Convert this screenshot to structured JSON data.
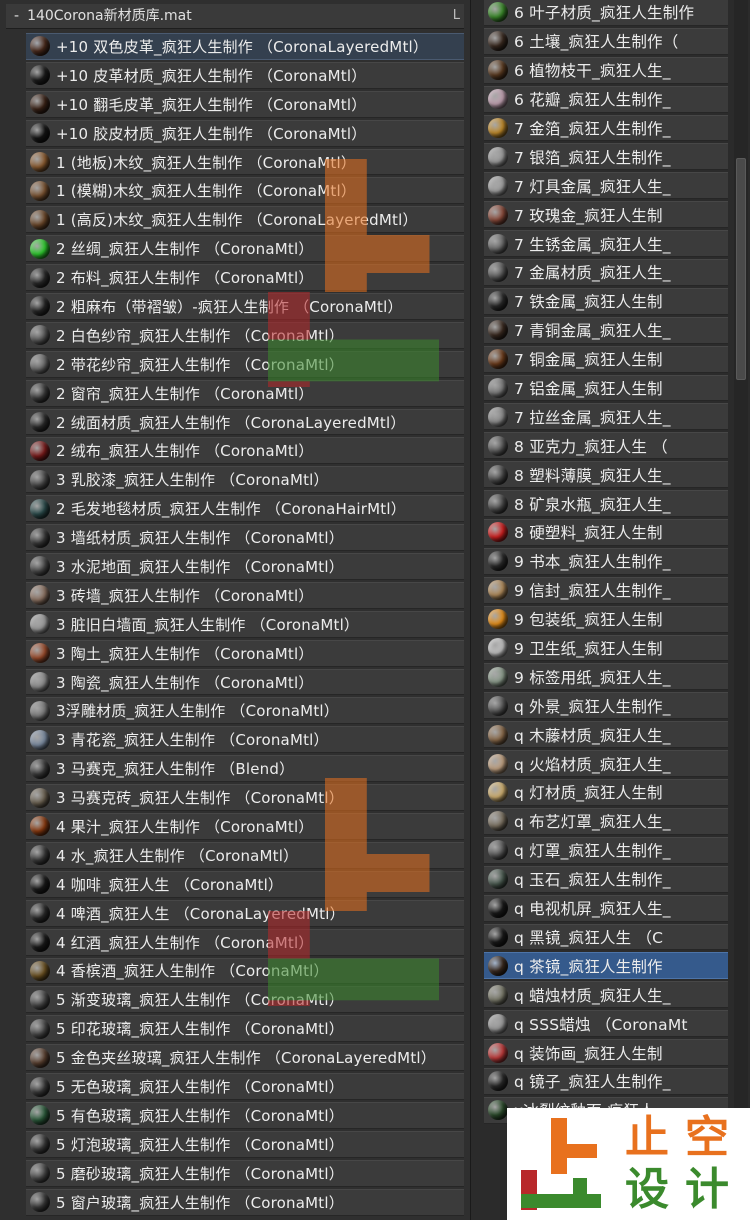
{
  "panel_title": "140Corona新材质库.mat",
  "collapse_symbol": "-",
  "corner_label": "L",
  "colors": {
    "row_bg": "#3b3b3b",
    "selected_left": "#34404f",
    "selected_right": "#355a8c",
    "watermark_orange": "#e8711e",
    "watermark_green": "#3b8a2d",
    "watermark_red": "#b8282a"
  },
  "left_items": [
    {
      "label": "+10 双色皮革_疯狂人生制作 （CoronaLayeredMtl）",
      "swatch": "#4a2a1c",
      "selected": true
    },
    {
      "label": "+10 皮革材质_疯狂人生制作 （CoronaMtl）",
      "swatch": "#1c1c1c"
    },
    {
      "label": "+10 翻毛皮革_疯狂人生制作 （CoronaMtl）",
      "swatch": "#3a2216"
    },
    {
      "label": "+10 胶皮材质_疯狂人生制作 （CoronaMtl）",
      "swatch": "#151515"
    },
    {
      "label": "1 (地板)木纹_疯狂人生制作 （CoronaMtl）",
      "swatch": "#8a5a2e"
    },
    {
      "label": "1 (模糊)木纹_疯狂人生制作 （CoronaMtl）",
      "swatch": "#7a5230"
    },
    {
      "label": "1 (高反)木纹_疯狂人生制作 （CoronaLayeredMtl）",
      "swatch": "#6a4628"
    },
    {
      "label": "2 丝绸_疯狂人生制作 （CoronaMtl）",
      "swatch": "#2ecc2e"
    },
    {
      "label": "2 布料_疯狂人生制作 （CoronaMtl）",
      "swatch": "#2a2a2a"
    },
    {
      "label": "2 粗麻布（带褶皱）-疯狂人生制作 （CoronaMtl）",
      "swatch": "#262626"
    },
    {
      "label": "2 白色纱帘_疯狂人生制作 （CoronaMtl）",
      "swatch": "#5a5a5a"
    },
    {
      "label": "2 带花纱帘_疯狂人生制作 （CoronaMtl）",
      "swatch": "#6a6a6a"
    },
    {
      "label": "2 窗帘_疯狂人生制作 （CoronaMtl）",
      "swatch": "#3a3a3a"
    },
    {
      "label": "2 绒面材质_疯狂人生制作 （CoronaLayeredMtl）",
      "swatch": "#2a2a2a"
    },
    {
      "label": "2 绒布_疯狂人生制作 （CoronaMtl）",
      "swatch": "#7a1a1a"
    },
    {
      "label": "3 乳胶漆_疯狂人生制作 （CoronaMtl）",
      "swatch": "#4a4a4a"
    },
    {
      "label": "2 毛发地毯材质_疯狂人生制作 （CoronaHairMtl）",
      "swatch": "#2a4a4a"
    },
    {
      "label": "3 墙纸材质_疯狂人生制作 （CoronaMtl）",
      "swatch": "#3a3a3a"
    },
    {
      "label": "3 水泥地面_疯狂人生制作 （CoronaMtl）",
      "swatch": "#4a4a4a"
    },
    {
      "label": "3 砖墙_疯狂人生制作 （CoronaMtl）",
      "swatch": "#8a7060"
    },
    {
      "label": "3 脏旧白墙面_疯狂人生制作 （CoronaMtl）",
      "swatch": "#9a9a9a"
    },
    {
      "label": "3 陶土_疯狂人生制作 （CoronaMtl）",
      "swatch": "#9a4a2a"
    },
    {
      "label": "3 陶瓷_疯狂人生制作 （CoronaMtl）",
      "swatch": "#8a8a8a"
    },
    {
      "label": "3浮雕材质_疯狂人生制作 （CoronaMtl）",
      "swatch": "#7a7a7a"
    },
    {
      "label": "3 青花瓷_疯狂人生制作 （CoronaMtl）",
      "swatch": "#7a8aa0"
    },
    {
      "label": "3 马赛克_疯狂人生制作 （Blend）",
      "swatch": "#3a3a3a"
    },
    {
      "label": "3 马赛克砖_疯狂人生制作 （CoronaMtl）",
      "swatch": "#6a6050"
    },
    {
      "label": "4 果汁_疯狂人生制作 （CoronaMtl）",
      "swatch": "#8a3a10"
    },
    {
      "label": "4 水_疯狂人生制作 （CoronaMtl）",
      "swatch": "#3a3a3a"
    },
    {
      "label": "4 咖啡_疯狂人生 （CoronaMtl）",
      "swatch": "#1a1a1a"
    },
    {
      "label": "4 啤酒_疯狂人生 （CoronaLayeredMtl）",
      "swatch": "#2a2a2a"
    },
    {
      "label": "4 红酒_疯狂人生制作 （CoronaMtl）",
      "swatch": "#1a1a1a"
    },
    {
      "label": "4 香槟酒_疯狂人生制作 （CoronaMtl）",
      "swatch": "#6a5020"
    },
    {
      "label": "5 渐变玻璃_疯狂人生制作 （CoronaMtl）",
      "swatch": "#4a4a4a"
    },
    {
      "label": "5 印花玻璃_疯狂人生制作 （CoronaMtl）",
      "swatch": "#4a4a4a"
    },
    {
      "label": "5 金色夹丝玻璃_疯狂人生制作 （CoronaLayeredMtl）",
      "swatch": "#5a4030"
    },
    {
      "label": "5 无色玻璃_疯狂人生制作 （CoronaMtl）",
      "swatch": "#3a3a3a"
    },
    {
      "label": "5 有色玻璃_疯狂人生制作 （CoronaMtl）",
      "swatch": "#2a5a3a"
    },
    {
      "label": "5 灯泡玻璃_疯狂人生制作 （CoronaMtl）",
      "swatch": "#3a3a3a"
    },
    {
      "label": "5 磨砂玻璃_疯狂人生制作 （CoronaMtl）",
      "swatch": "#4a4a4a"
    },
    {
      "label": "5 窗户玻璃_疯狂人生制作 （CoronaMtl）",
      "swatch": "#3a3a3a"
    }
  ],
  "right_items": [
    {
      "label": "6 叶子材质_疯狂人生制作",
      "swatch": "#3a8a2a"
    },
    {
      "label": "6 土壤_疯狂人生制作（",
      "swatch": "#3a2a20"
    },
    {
      "label": "6 植物枝干_疯狂人生_",
      "swatch": "#5a3a20"
    },
    {
      "label": "6 花瓣_疯狂人生制作_",
      "swatch": "#c0a0b0"
    },
    {
      "label": "7 金箔_疯狂人生制作_",
      "swatch": "#c08a2a"
    },
    {
      "label": "7 银箔_疯狂人生制作_",
      "swatch": "#9a9a9a"
    },
    {
      "label": "7 灯具金属_疯狂人生_",
      "swatch": "#a0a0a0"
    },
    {
      "label": "7 玫瑰金_疯狂人生制",
      "swatch": "#8a4a3a"
    },
    {
      "label": "7 生锈金属_疯狂人生_",
      "swatch": "#6a6a6a"
    },
    {
      "label": "7 金属材质_疯狂人生_",
      "swatch": "#5a5a5a"
    },
    {
      "label": "7 铁金属_疯狂人生制",
      "swatch": "#2a2a2a"
    },
    {
      "label": "7 青铜金属_疯狂人生_",
      "swatch": "#3a2a20"
    },
    {
      "label": "7 铜金属_疯狂人生制",
      "swatch": "#6a3a1a"
    },
    {
      "label": "7 铝金属_疯狂人生制",
      "swatch": "#7a7a7a"
    },
    {
      "label": "7 拉丝金属_疯狂人生_",
      "swatch": "#8a8a8a"
    },
    {
      "label": "8 亚克力_疯狂人生 （",
      "swatch": "#5a5a5a"
    },
    {
      "label": "8 塑料薄膜_疯狂人生_",
      "swatch": "#4a4a4a"
    },
    {
      "label": "8 矿泉水瓶_疯狂人生_",
      "swatch": "#4a4a4a"
    },
    {
      "label": "8 硬塑料_疯狂人生制",
      "swatch": "#d02020"
    },
    {
      "label": "9 书本_疯狂人生制作_",
      "swatch": "#2a2a2a"
    },
    {
      "label": "9 信封_疯狂人生制作_",
      "swatch": "#b08a5a"
    },
    {
      "label": "9 包装纸_疯狂人生制",
      "swatch": "#e8901a"
    },
    {
      "label": "9 卫生纸_疯狂人生制",
      "swatch": "#c0c0c0"
    },
    {
      "label": "9 标签用纸_疯狂人生_",
      "swatch": "#8a9a8a"
    },
    {
      "label": "q 外景_疯狂人生制作_",
      "swatch": "#5a5a5a"
    },
    {
      "label": "q 木藤材质_疯狂人生_",
      "swatch": "#8a6a4a"
    },
    {
      "label": "q 火焰材质_疯狂人生_",
      "swatch": "#c0a080"
    },
    {
      "label": "q 灯材质_疯狂人生制",
      "swatch": "#d0b070"
    },
    {
      "label": "q 布艺灯罩_疯狂人生_",
      "swatch": "#7a7060"
    },
    {
      "label": "q 灯罩_疯狂人生制作_",
      "swatch": "#5a5a5a"
    },
    {
      "label": "q 玉石_疯狂人生制作_",
      "swatch": "#4a5a50"
    },
    {
      "label": "q 电视机屏_疯狂人生_",
      "swatch": "#1a1a1a"
    },
    {
      "label": "q 黑镜_疯狂人生 （C",
      "swatch": "#1a1a1a"
    },
    {
      "label": "q 茶镜_疯狂人生制作",
      "swatch": "#3a2a20",
      "selected": true
    },
    {
      "label": "q 蜡烛材质_疯狂人生_",
      "swatch": "#7a7a6a"
    },
    {
      "label": "q SSS蜡烛 （CoronaMt",
      "swatch": "#9a9a9a"
    },
    {
      "label": "q 装饰画_疯狂人生制",
      "swatch": "#c03a3a"
    },
    {
      "label": "q 镜子_疯狂人生制作_",
      "swatch": "#2a2a2a"
    },
    {
      "label": "x冰裂纹釉面-疯狂人",
      "swatch": "#2a4a2a"
    }
  ],
  "watermark": {
    "chars": [
      "止",
      "空",
      "设",
      "计"
    ]
  }
}
